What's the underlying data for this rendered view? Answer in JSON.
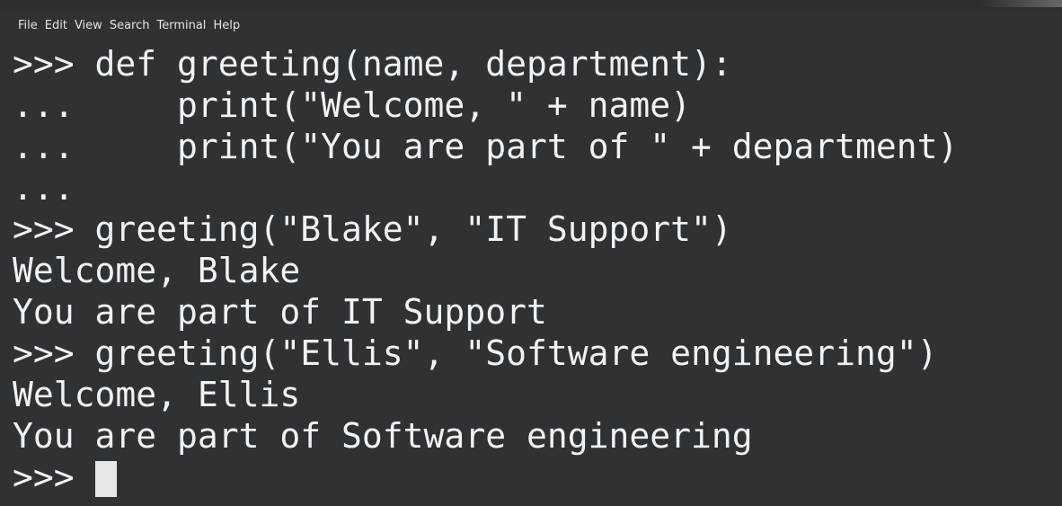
{
  "menu": {
    "items": [
      "File",
      "Edit",
      "View",
      "Search",
      "Terminal",
      "Help"
    ]
  },
  "terminal": {
    "lines": [
      ">>> def greeting(name, department):",
      "...     print(\"Welcome, \" + name)",
      "...     print(\"You are part of \" + department)",
      "...",
      ">>> greeting(\"Blake\", \"IT Support\")",
      "Welcome, Blake",
      "You are part of IT Support",
      ">>> greeting(\"Ellis\", \"Software engineering\")",
      "Welcome, Ellis",
      "You are part of Software engineering"
    ],
    "prompt": ">>> "
  },
  "colors": {
    "background": "#2f3234",
    "text": "#f2f2f2",
    "cursor": "#e6e6e6"
  }
}
